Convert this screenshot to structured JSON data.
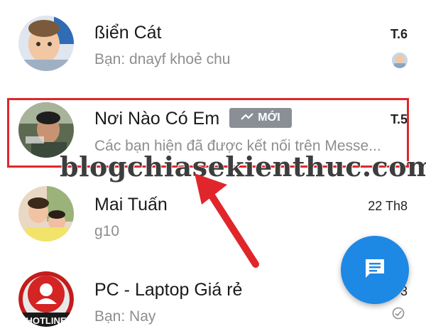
{
  "conversations": [
    {
      "name": "ßiển Cát",
      "preview": "Bạn: dnayf khoẻ chu",
      "time": "T.6"
    },
    {
      "name": "Nơi Nào Có Em",
      "badge": "MỚI",
      "preview": "Các bạn hiện đã được kết nối trên Messe...",
      "time": "T.5"
    },
    {
      "name": "Mai Tuấn",
      "preview": "g10",
      "time": "22 Th8"
    },
    {
      "name": "PC - Laptop Giá rẻ",
      "preview": "Bạn: Nay",
      "time": "3"
    }
  ],
  "watermark": "blogchiasekienthuc.com",
  "avatar_text": "HOTLINE",
  "colors": {
    "accent": "#1e88e5",
    "highlight": "#e0262b",
    "badge": "#8a8f96"
  },
  "icons": {
    "fab": "compose-message-icon",
    "badge": "wave-icon",
    "read": "check-circle-icon"
  }
}
